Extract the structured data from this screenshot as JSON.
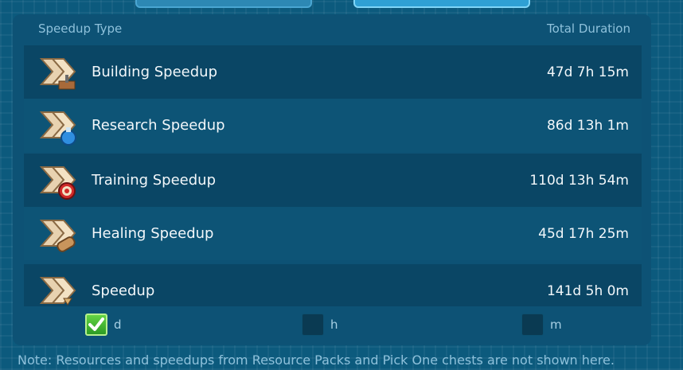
{
  "columns": {
    "type_header": "Speedup Type",
    "duration_header": "Total Duration"
  },
  "rows": [
    {
      "label": "Building Speedup",
      "duration": "47d 7h 15m",
      "icon": "building-speedup-icon"
    },
    {
      "label": "Research Speedup",
      "duration": "86d 13h 1m",
      "icon": "research-speedup-icon"
    },
    {
      "label": "Training Speedup",
      "duration": "110d 13h 54m",
      "icon": "training-speedup-icon"
    },
    {
      "label": "Healing Speedup",
      "duration": "45d 17h 25m",
      "icon": "healing-speedup-icon"
    },
    {
      "label": "Speedup",
      "duration": "141d 5h 0m",
      "icon": "speedup-icon"
    }
  ],
  "filters": [
    {
      "label": "d",
      "checked": true
    },
    {
      "label": "h",
      "checked": false
    },
    {
      "label": "m",
      "checked": false
    }
  ],
  "note": "Note: Resources and speedups from Resource Packs and Pick One chests are not shown here.",
  "colors": {
    "accent_check": "#3cb82c",
    "panel_bg": "#0d5275"
  }
}
